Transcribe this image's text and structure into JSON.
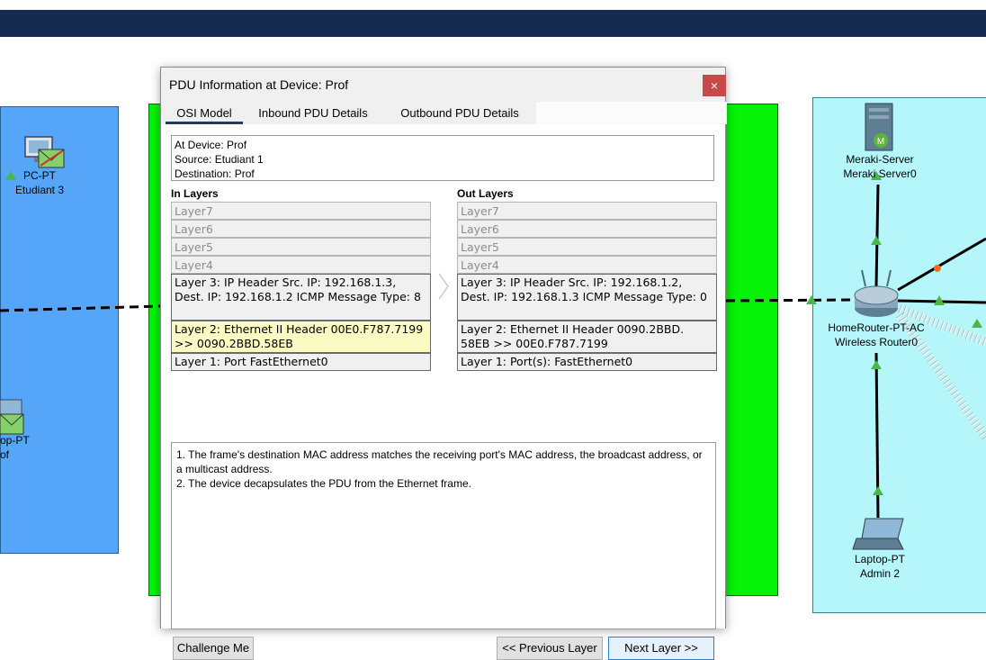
{
  "workspace": {
    "devices": [
      {
        "id": "etudiant3",
        "line1": "PC-PT",
        "line2": "Etudiant 3"
      },
      {
        "id": "prof",
        "line1": "op-PT",
        "line2": "of"
      },
      {
        "id": "meraki",
        "line1": "Meraki-Server",
        "line2": "Meraki Server0"
      },
      {
        "id": "router",
        "line1": "HomeRouter-PT-AC",
        "line2": "Wireless Router0"
      },
      {
        "id": "admin2",
        "line1": "Laptop-PT",
        "line2": "Admin 2"
      }
    ]
  },
  "dialog": {
    "title": "PDU Information at Device: Prof",
    "close_label": "×",
    "tabs": [
      "OSI Model",
      "Inbound PDU Details",
      "Outbound PDU Details"
    ],
    "info": {
      "device": "At Device: Prof",
      "source": "Source: Etudiant 1",
      "destination": "Destination: Prof"
    },
    "in_layers_title": "In Layers",
    "out_layers_title": "Out Layers",
    "in_layers": [
      "Layer7",
      "Layer6",
      "Layer5",
      "Layer4",
      "Layer 3: IP Header Src. IP: 192.168.1.3, Dest. IP: 192.168.1.2 ICMP Message Type: 8",
      "Layer 2: Ethernet II Header 00E0.F787.7199 >> 0090.2BBD.58EB",
      "Layer 1: Port FastEthernet0"
    ],
    "out_layers": [
      "Layer7",
      "Layer6",
      "Layer5",
      "Layer4",
      "Layer 3: IP Header Src. IP: 192.168.1.2, Dest. IP: 192.168.1.3 ICMP Message Type: 0",
      "Layer 2: Ethernet II Header 0090.2BBD. 58EB >> 00E0.F787.7199",
      "Layer 1: Port(s): FastEthernet0"
    ],
    "description": [
      "1. The frame's destination MAC address matches the receiving port's MAC address, the broadcast address, or a multicast address.",
      "2. The device decapsulates the PDU from the Ethernet frame."
    ],
    "buttons": {
      "challenge": "Challenge Me",
      "previous": "<< Previous Layer",
      "next": "Next Layer >>"
    }
  }
}
